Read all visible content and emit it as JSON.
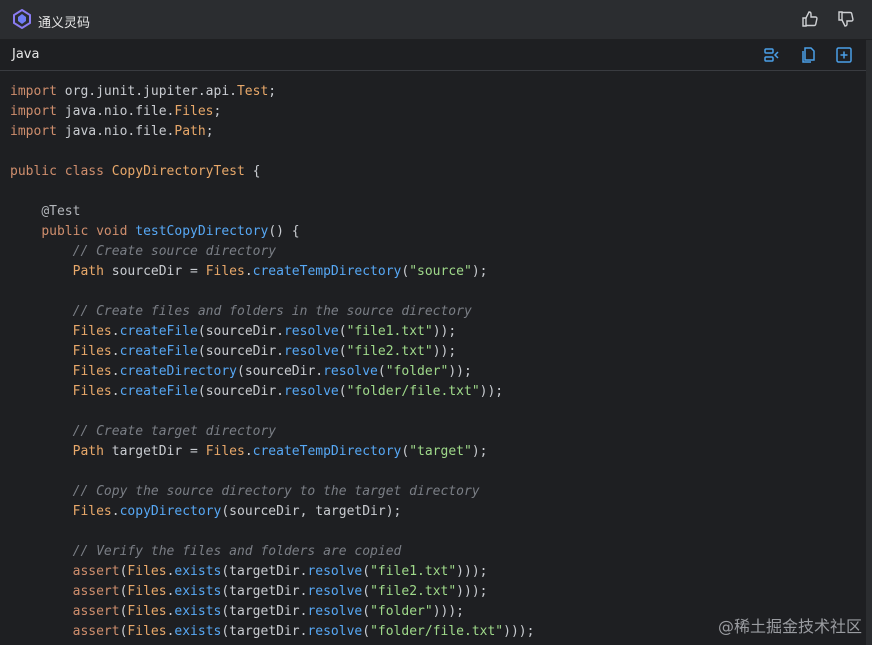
{
  "app": {
    "title": "通义灵码"
  },
  "toolbar": {
    "thumbs_up_icon": "thumbs-up-icon",
    "thumbs_down_icon": "thumbs-down-icon"
  },
  "code_block": {
    "language": "Java",
    "actions": [
      "insert-code-icon",
      "copy-icon",
      "new-file-icon"
    ],
    "lines": [
      [
        {
          "t": "import",
          "c": "kw"
        },
        {
          "t": " org.junit.jupiter.api.",
          "c": "id"
        },
        {
          "t": "Test",
          "c": "ty"
        },
        {
          "t": ";",
          "c": "op"
        }
      ],
      [
        {
          "t": "import",
          "c": "kw"
        },
        {
          "t": " java.nio.file.",
          "c": "id"
        },
        {
          "t": "Files",
          "c": "ty"
        },
        {
          "t": ";",
          "c": "op"
        }
      ],
      [
        {
          "t": "import",
          "c": "kw"
        },
        {
          "t": " java.nio.file.",
          "c": "id"
        },
        {
          "t": "Path",
          "c": "ty"
        },
        {
          "t": ";",
          "c": "op"
        }
      ],
      [],
      [
        {
          "t": "public",
          "c": "kw"
        },
        {
          "t": " ",
          "c": "id"
        },
        {
          "t": "class",
          "c": "kw"
        },
        {
          "t": " ",
          "c": "id"
        },
        {
          "t": "CopyDirectoryTest",
          "c": "cls"
        },
        {
          "t": " {",
          "c": "op"
        }
      ],
      [],
      [
        {
          "t": "    ",
          "c": "id"
        },
        {
          "t": "@Test",
          "c": "an"
        }
      ],
      [
        {
          "t": "    ",
          "c": "id"
        },
        {
          "t": "public",
          "c": "kw"
        },
        {
          "t": " ",
          "c": "id"
        },
        {
          "t": "void",
          "c": "kw"
        },
        {
          "t": " ",
          "c": "id"
        },
        {
          "t": "testCopyDirectory",
          "c": "fn"
        },
        {
          "t": "() {",
          "c": "op"
        }
      ],
      [
        {
          "t": "        ",
          "c": "id"
        },
        {
          "t": "// Create source directory",
          "c": "cm"
        }
      ],
      [
        {
          "t": "        ",
          "c": "id"
        },
        {
          "t": "Path",
          "c": "ty"
        },
        {
          "t": " sourceDir = ",
          "c": "id"
        },
        {
          "t": "Files",
          "c": "ty"
        },
        {
          "t": ".",
          "c": "op"
        },
        {
          "t": "createTempDirectory",
          "c": "fn"
        },
        {
          "t": "(",
          "c": "op"
        },
        {
          "t": "\"source\"",
          "c": "str"
        },
        {
          "t": ");",
          "c": "op"
        }
      ],
      [],
      [
        {
          "t": "        ",
          "c": "id"
        },
        {
          "t": "// Create files and folders in the source directory",
          "c": "cm"
        }
      ],
      [
        {
          "t": "        ",
          "c": "id"
        },
        {
          "t": "Files",
          "c": "ty"
        },
        {
          "t": ".",
          "c": "op"
        },
        {
          "t": "createFile",
          "c": "fn"
        },
        {
          "t": "(sourceDir.",
          "c": "id"
        },
        {
          "t": "resolve",
          "c": "fn"
        },
        {
          "t": "(",
          "c": "op"
        },
        {
          "t": "\"file1.txt\"",
          "c": "str"
        },
        {
          "t": "));",
          "c": "op"
        }
      ],
      [
        {
          "t": "        ",
          "c": "id"
        },
        {
          "t": "Files",
          "c": "ty"
        },
        {
          "t": ".",
          "c": "op"
        },
        {
          "t": "createFile",
          "c": "fn"
        },
        {
          "t": "(sourceDir.",
          "c": "id"
        },
        {
          "t": "resolve",
          "c": "fn"
        },
        {
          "t": "(",
          "c": "op"
        },
        {
          "t": "\"file2.txt\"",
          "c": "str"
        },
        {
          "t": "));",
          "c": "op"
        }
      ],
      [
        {
          "t": "        ",
          "c": "id"
        },
        {
          "t": "Files",
          "c": "ty"
        },
        {
          "t": ".",
          "c": "op"
        },
        {
          "t": "createDirectory",
          "c": "fn"
        },
        {
          "t": "(sourceDir.",
          "c": "id"
        },
        {
          "t": "resolve",
          "c": "fn"
        },
        {
          "t": "(",
          "c": "op"
        },
        {
          "t": "\"folder\"",
          "c": "str"
        },
        {
          "t": "));",
          "c": "op"
        }
      ],
      [
        {
          "t": "        ",
          "c": "id"
        },
        {
          "t": "Files",
          "c": "ty"
        },
        {
          "t": ".",
          "c": "op"
        },
        {
          "t": "createFile",
          "c": "fn"
        },
        {
          "t": "(sourceDir.",
          "c": "id"
        },
        {
          "t": "resolve",
          "c": "fn"
        },
        {
          "t": "(",
          "c": "op"
        },
        {
          "t": "\"folder/file.txt\"",
          "c": "str"
        },
        {
          "t": "));",
          "c": "op"
        }
      ],
      [],
      [
        {
          "t": "        ",
          "c": "id"
        },
        {
          "t": "// Create target directory",
          "c": "cm"
        }
      ],
      [
        {
          "t": "        ",
          "c": "id"
        },
        {
          "t": "Path",
          "c": "ty"
        },
        {
          "t": " targetDir = ",
          "c": "id"
        },
        {
          "t": "Files",
          "c": "ty"
        },
        {
          "t": ".",
          "c": "op"
        },
        {
          "t": "createTempDirectory",
          "c": "fn"
        },
        {
          "t": "(",
          "c": "op"
        },
        {
          "t": "\"target\"",
          "c": "str"
        },
        {
          "t": ");",
          "c": "op"
        }
      ],
      [],
      [
        {
          "t": "        ",
          "c": "id"
        },
        {
          "t": "// Copy the source directory to the target directory",
          "c": "cm"
        }
      ],
      [
        {
          "t": "        ",
          "c": "id"
        },
        {
          "t": "Files",
          "c": "ty"
        },
        {
          "t": ".",
          "c": "op"
        },
        {
          "t": "copyDirectory",
          "c": "fn"
        },
        {
          "t": "(sourceDir, targetDir);",
          "c": "id"
        }
      ],
      [],
      [
        {
          "t": "        ",
          "c": "id"
        },
        {
          "t": "// Verify the files and folders are copied",
          "c": "cm"
        }
      ],
      [
        {
          "t": "        ",
          "c": "id"
        },
        {
          "t": "assert",
          "c": "kw"
        },
        {
          "t": "(",
          "c": "op"
        },
        {
          "t": "Files",
          "c": "ty"
        },
        {
          "t": ".",
          "c": "op"
        },
        {
          "t": "exists",
          "c": "fn"
        },
        {
          "t": "(targetDir.",
          "c": "id"
        },
        {
          "t": "resolve",
          "c": "fn"
        },
        {
          "t": "(",
          "c": "op"
        },
        {
          "t": "\"file1.txt\"",
          "c": "str"
        },
        {
          "t": ")));",
          "c": "op"
        }
      ],
      [
        {
          "t": "        ",
          "c": "id"
        },
        {
          "t": "assert",
          "c": "kw"
        },
        {
          "t": "(",
          "c": "op"
        },
        {
          "t": "Files",
          "c": "ty"
        },
        {
          "t": ".",
          "c": "op"
        },
        {
          "t": "exists",
          "c": "fn"
        },
        {
          "t": "(targetDir.",
          "c": "id"
        },
        {
          "t": "resolve",
          "c": "fn"
        },
        {
          "t": "(",
          "c": "op"
        },
        {
          "t": "\"file2.txt\"",
          "c": "str"
        },
        {
          "t": ")));",
          "c": "op"
        }
      ],
      [
        {
          "t": "        ",
          "c": "id"
        },
        {
          "t": "assert",
          "c": "kw"
        },
        {
          "t": "(",
          "c": "op"
        },
        {
          "t": "Files",
          "c": "ty"
        },
        {
          "t": ".",
          "c": "op"
        },
        {
          "t": "exists",
          "c": "fn"
        },
        {
          "t": "(targetDir.",
          "c": "id"
        },
        {
          "t": "resolve",
          "c": "fn"
        },
        {
          "t": "(",
          "c": "op"
        },
        {
          "t": "\"folder\"",
          "c": "str"
        },
        {
          "t": ")));",
          "c": "op"
        }
      ],
      [
        {
          "t": "        ",
          "c": "id"
        },
        {
          "t": "assert",
          "c": "kw"
        },
        {
          "t": "(",
          "c": "op"
        },
        {
          "t": "Files",
          "c": "ty"
        },
        {
          "t": ".",
          "c": "op"
        },
        {
          "t": "exists",
          "c": "fn"
        },
        {
          "t": "(targetDir.",
          "c": "id"
        },
        {
          "t": "resolve",
          "c": "fn"
        },
        {
          "t": "(",
          "c": "op"
        },
        {
          "t": "\"folder/file.txt\"",
          "c": "str"
        },
        {
          "t": ")));",
          "c": "op"
        }
      ]
    ]
  },
  "watermark": "@稀土掘金技术社区",
  "colors": {
    "accent": "#4a9fe8",
    "keyword": "#cf8e6d",
    "type": "#e8a86a",
    "function": "#57a8f5",
    "string": "#9fd98a",
    "comment": "#7a7e85"
  }
}
